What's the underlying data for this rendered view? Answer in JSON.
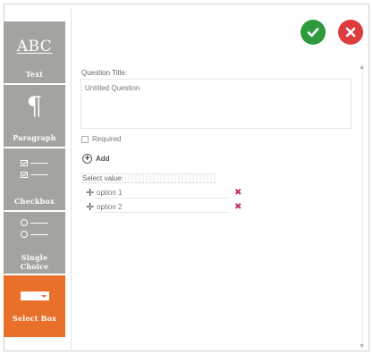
{
  "sidebar": {
    "items": [
      {
        "label": "Text",
        "icon_text": "ABC",
        "icon": "abc-text-icon"
      },
      {
        "label": "Paragraph",
        "icon_text": "¶",
        "icon": "pilcrow-icon"
      },
      {
        "label": "Checkbox",
        "icon": "checkbox-list-icon"
      },
      {
        "label": "Single\nChoice",
        "icon": "radio-list-icon"
      },
      {
        "label": "Select Box",
        "icon": "select-box-icon",
        "active": true
      }
    ],
    "colors": {
      "tile": "#a3a3a0",
      "active": "#e8702a"
    }
  },
  "actions": {
    "confirm_icon": "check-icon",
    "cancel_icon": "close-icon",
    "confirm_color": "#2f9a3c",
    "cancel_color": "#de3d3f"
  },
  "form": {
    "title_label": "Question Title:",
    "title_value": "Untitled Question",
    "required_label": "Required",
    "required_checked": false,
    "add_label": "Add",
    "select_label": "Select value:",
    "options": [
      {
        "value": "option 1"
      },
      {
        "value": "option 2"
      }
    ]
  }
}
